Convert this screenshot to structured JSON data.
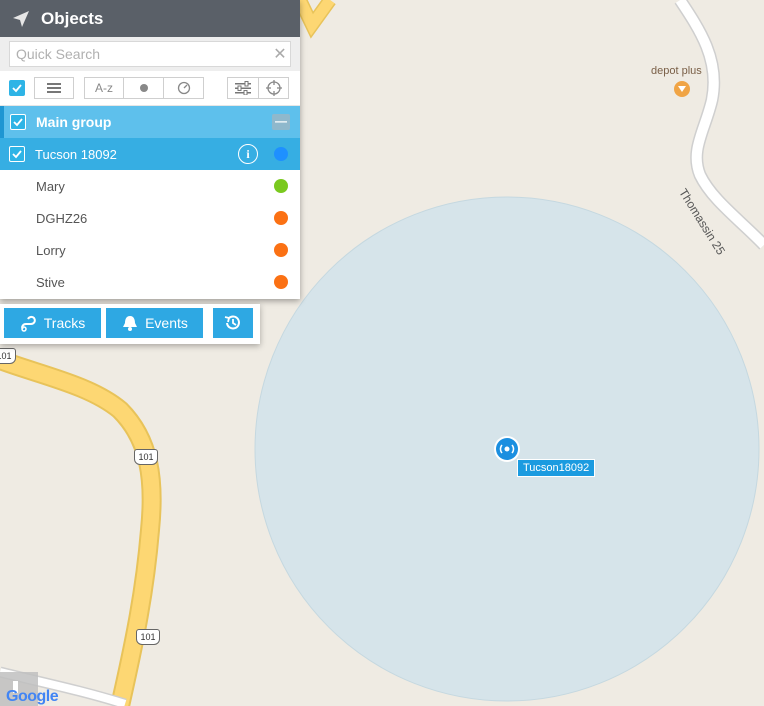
{
  "panel": {
    "title": "Objects",
    "search": {
      "placeholder": "Quick Search",
      "value": ""
    },
    "toolbar": {
      "sort_label": "A-z"
    }
  },
  "group": {
    "name": "Main group",
    "checked": true
  },
  "objects": [
    {
      "name": "Tucson 18092",
      "selected": true,
      "checked": true,
      "status_color": "#1e90ff"
    },
    {
      "name": "Mary",
      "selected": false,
      "checked": false,
      "status_color": "#7ac91f"
    },
    {
      "name": "DGHZ26",
      "selected": false,
      "checked": false,
      "status_color": "#fb7114"
    },
    {
      "name": "Lorry",
      "selected": false,
      "checked": false,
      "status_color": "#fb7114"
    },
    {
      "name": "Stive",
      "selected": false,
      "checked": false,
      "status_color": "#fb7114"
    }
  ],
  "actions": {
    "tracks": "Tracks",
    "events": "Events"
  },
  "map": {
    "marker_label": "Tucson18092",
    "poi_name": "depot plus",
    "road_name": "Thomassin 25",
    "shield_top": "101",
    "shield_mid": "101",
    "shield_bottom": "101",
    "attribution": "Google"
  },
  "colors": {
    "accent": "#2ea8e3",
    "header": "#5a6068",
    "geofence": "#d6e4ea"
  }
}
